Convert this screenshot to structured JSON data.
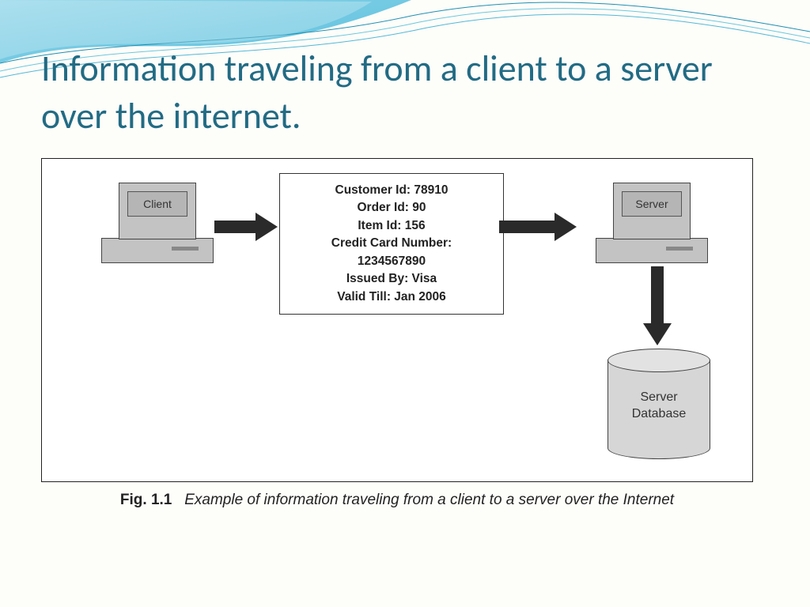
{
  "title": "Information traveling from a client to a server over the internet.",
  "caption_label": "Fig. 1.1",
  "caption_text": "Example of information traveling from a client to a server over the Internet",
  "diagram": {
    "client_label": "Client",
    "server_label": "Server",
    "database_label_line1": "Server",
    "database_label_line2": "Database",
    "payload": {
      "customer_id": "Customer Id: 78910",
      "order_id": "Order Id: 90",
      "item_id": "Item Id: 156",
      "cc_label": "Credit Card Number:",
      "cc_number": "1234567890",
      "issued_by": "Issued By: Visa",
      "valid_till": "Valid Till: Jan 2006"
    }
  }
}
